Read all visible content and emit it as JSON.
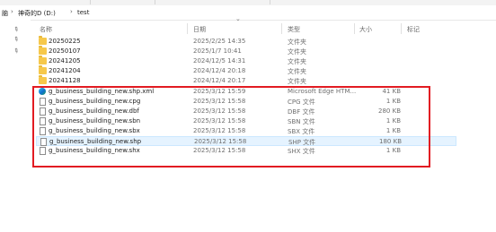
{
  "address": {
    "segments": [
      "脑",
      "神奇的D (D:)",
      "test"
    ]
  },
  "columns": {
    "name": "名称",
    "date": "日期",
    "type": "类型",
    "size": "大小",
    "tag": "标记"
  },
  "rows": [
    {
      "name": "20250225",
      "date": "2025/2/25 14:35",
      "type": "文件夹",
      "size": "",
      "icon": "folder-icon",
      "selected": false
    },
    {
      "name": "20250107",
      "date": "2025/1/7 10:41",
      "type": "文件夹",
      "size": "",
      "icon": "folder-icon",
      "selected": false
    },
    {
      "name": "20241205",
      "date": "2024/12/5 14:31",
      "type": "文件夹",
      "size": "",
      "icon": "folder-icon",
      "selected": false
    },
    {
      "name": "20241204",
      "date": "2024/12/4 20:18",
      "type": "文件夹",
      "size": "",
      "icon": "folder-icon",
      "selected": false
    },
    {
      "name": "20241128",
      "date": "2024/12/4 20:17",
      "type": "文件夹",
      "size": "",
      "icon": "folder-icon",
      "selected": false
    },
    {
      "name": "g_business_building_new.shp.xml",
      "date": "2025/3/12 15:59",
      "type": "Microsoft Edge HTM...",
      "size": "41 KB",
      "icon": "edge-icon",
      "selected": false
    },
    {
      "name": "g_business_building_new.cpg",
      "date": "2025/3/12 15:58",
      "type": "CPG 文件",
      "size": "1 KB",
      "icon": "file-icon",
      "selected": false
    },
    {
      "name": "g_business_building_new.dbf",
      "date": "2025/3/12 15:58",
      "type": "DBF 文件",
      "size": "280 KB",
      "icon": "file-icon",
      "selected": false
    },
    {
      "name": "g_business_building_new.sbn",
      "date": "2025/3/12 15:58",
      "type": "SBN 文件",
      "size": "1 KB",
      "icon": "file-icon",
      "selected": false
    },
    {
      "name": "g_business_building_new.sbx",
      "date": "2025/3/12 15:58",
      "type": "SBX 文件",
      "size": "1 KB",
      "icon": "file-icon",
      "selected": false
    },
    {
      "name": "g_business_building_new.shp",
      "date": "2025/3/12 15:58",
      "type": "SHP 文件",
      "size": "180 KB",
      "icon": "file-icon",
      "selected": true
    },
    {
      "name": "g_business_building_new.shx",
      "date": "2025/3/12 15:58",
      "type": "SHX 文件",
      "size": "1 KB",
      "icon": "file-icon",
      "selected": false
    }
  ],
  "colors": {
    "highlight_border": "#e21b22",
    "selected_row": "#e5f3ff",
    "folder": "#f6c84b"
  }
}
